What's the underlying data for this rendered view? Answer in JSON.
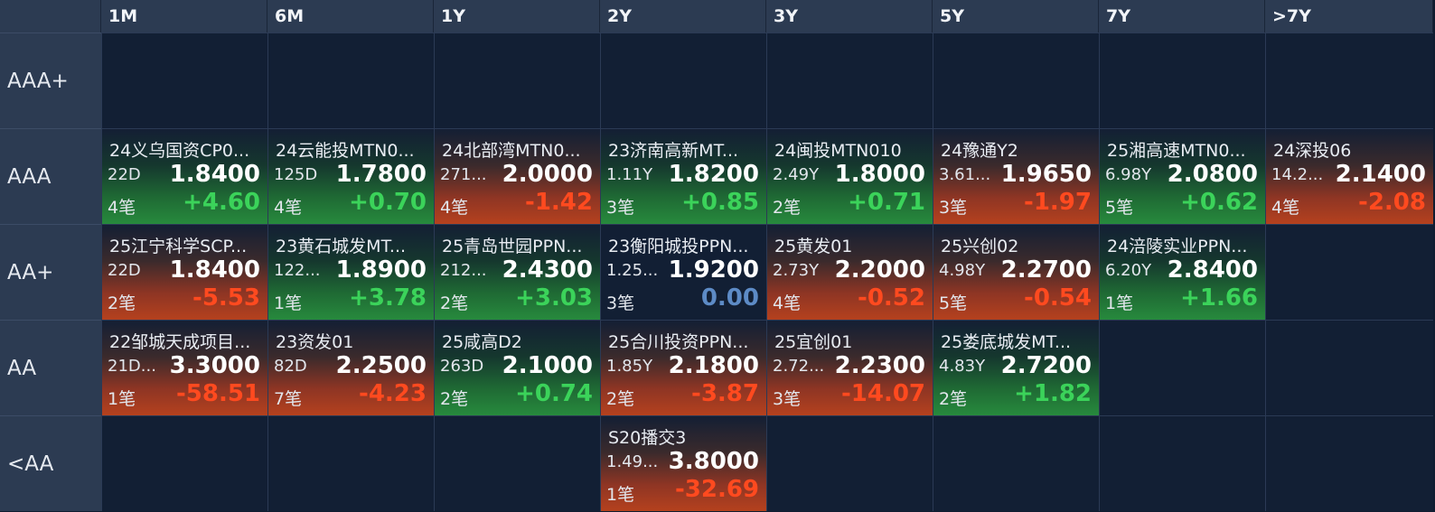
{
  "columns": [
    "1M",
    "6M",
    "1Y",
    "2Y",
    "3Y",
    "5Y",
    "7Y",
    ">7Y"
  ],
  "rows": [
    "AAA+",
    "AAA",
    "AA+",
    "AA",
    "<AA"
  ],
  "colors": {
    "up": "#3bd35a",
    "down": "#ff4a1f",
    "flat": "#5d8bc6",
    "header_bg": "#2c3b52",
    "grid_bg": "#121f34"
  },
  "cells": {
    "AAA": [
      {
        "col": 0,
        "name": "24义乌国资CP0...",
        "term": "22D",
        "yield": "1.8400",
        "count": "4笔",
        "change": "+4.60",
        "dir": "up"
      },
      {
        "col": 1,
        "name": "24云能投MTN0...",
        "term": "125D",
        "yield": "1.7800",
        "count": "4笔",
        "change": "+0.70",
        "dir": "up"
      },
      {
        "col": 2,
        "name": "24北部湾MTN0...",
        "term": "271...",
        "yield": "2.0000",
        "count": "4笔",
        "change": "-1.42",
        "dir": "down"
      },
      {
        "col": 3,
        "name": "23济南高新MT...",
        "term": "1.11Y",
        "yield": "1.8200",
        "count": "3笔",
        "change": "+0.85",
        "dir": "up"
      },
      {
        "col": 4,
        "name": "24闽投MTN010",
        "term": "2.49Y",
        "yield": "1.8000",
        "count": "2笔",
        "change": "+0.71",
        "dir": "up"
      },
      {
        "col": 5,
        "name": "24豫通Y2",
        "term": "3.61...",
        "yield": "1.9650",
        "count": "3笔",
        "change": "-1.97",
        "dir": "down"
      },
      {
        "col": 6,
        "name": "25湘高速MTN0...",
        "term": "6.98Y",
        "yield": "2.0800",
        "count": "5笔",
        "change": "+0.62",
        "dir": "up"
      },
      {
        "col": 7,
        "name": "24深投06",
        "term": "14.2...",
        "yield": "2.1400",
        "count": "4笔",
        "change": "-2.08",
        "dir": "down"
      }
    ],
    "AA+": [
      {
        "col": 0,
        "name": "25江宁科学SCP...",
        "term": "22D",
        "yield": "1.8400",
        "count": "2笔",
        "change": "-5.53",
        "dir": "down"
      },
      {
        "col": 1,
        "name": "23黄石城发MT...",
        "term": "122...",
        "yield": "1.8900",
        "count": "1笔",
        "change": "+3.78",
        "dir": "up"
      },
      {
        "col": 2,
        "name": "25青岛世园PPN...",
        "term": "212...",
        "yield": "2.4300",
        "count": "2笔",
        "change": "+3.03",
        "dir": "up"
      },
      {
        "col": 3,
        "name": "23衡阳城投PPN...",
        "term": "1.25...",
        "yield": "1.9200",
        "count": "3笔",
        "change": "0.00",
        "dir": "flat"
      },
      {
        "col": 4,
        "name": "25黄发01",
        "term": "2.73Y",
        "yield": "2.2000",
        "count": "4笔",
        "change": "-0.52",
        "dir": "down"
      },
      {
        "col": 5,
        "name": "25兴创02",
        "term": "4.98Y",
        "yield": "2.2700",
        "count": "5笔",
        "change": "-0.54",
        "dir": "down"
      },
      {
        "col": 6,
        "name": "24涪陵实业PPN...",
        "term": "6.20Y",
        "yield": "2.8400",
        "count": "1笔",
        "change": "+1.66",
        "dir": "up"
      }
    ],
    "AA": [
      {
        "col": 0,
        "name": "22邹城天成项目...",
        "term": "21D...",
        "yield": "3.3000",
        "count": "1笔",
        "change": "-58.51",
        "dir": "down"
      },
      {
        "col": 1,
        "name": "23资发01",
        "term": "82D",
        "yield": "2.2500",
        "count": "7笔",
        "change": "-4.23",
        "dir": "down"
      },
      {
        "col": 2,
        "name": "25咸高D2",
        "term": "263D",
        "yield": "2.1000",
        "count": "2笔",
        "change": "+0.74",
        "dir": "up"
      },
      {
        "col": 3,
        "name": "25合川投资PPN...",
        "term": "1.85Y",
        "yield": "2.1800",
        "count": "2笔",
        "change": "-3.87",
        "dir": "down"
      },
      {
        "col": 4,
        "name": "25宜创01",
        "term": "2.72...",
        "yield": "2.2300",
        "count": "3笔",
        "change": "-14.07",
        "dir": "down"
      },
      {
        "col": 5,
        "name": "25娄底城发MT...",
        "term": "4.83Y",
        "yield": "2.7200",
        "count": "2笔",
        "change": "+1.82",
        "dir": "up"
      }
    ],
    "<AA": [
      {
        "col": 3,
        "name": "S20播交3",
        "term": "1.49...",
        "yield": "3.8000",
        "count": "1笔",
        "change": "-32.69",
        "dir": "down"
      }
    ]
  }
}
